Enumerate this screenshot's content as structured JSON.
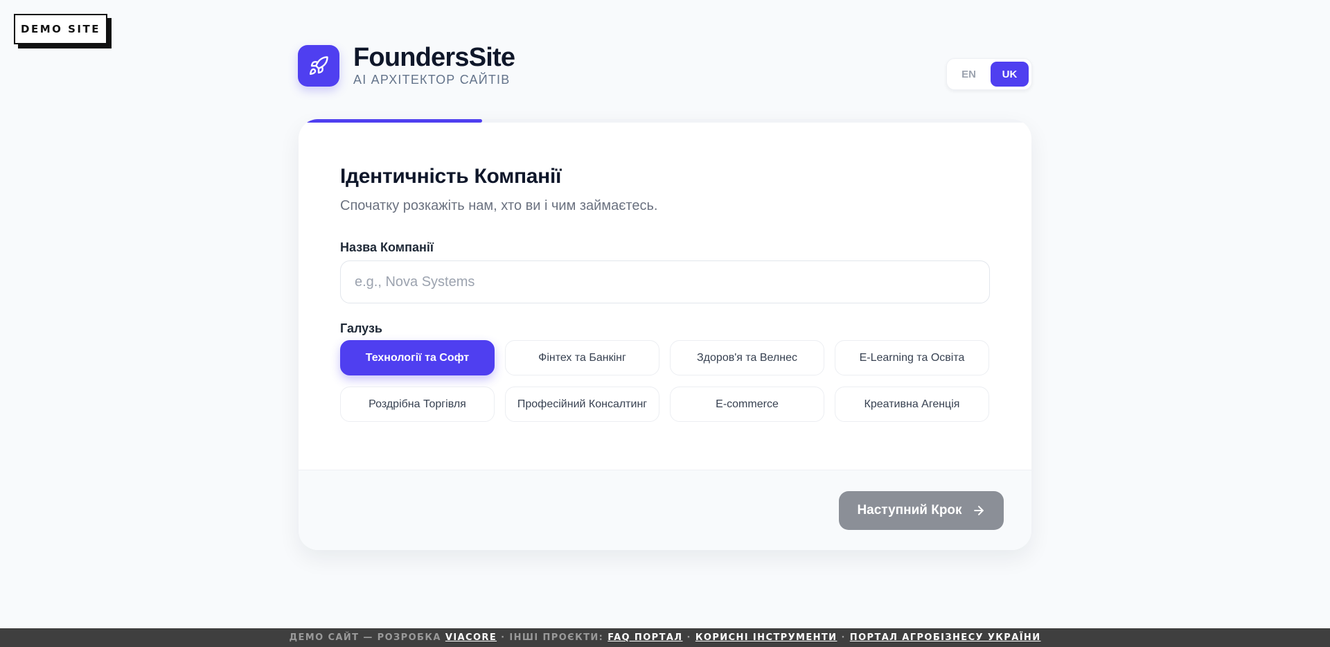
{
  "demo_badge": "DEMO SITE",
  "brand": {
    "title": "FoundersSite",
    "subtitle": "AI АРХІТЕКТОР САЙТІВ",
    "logo_icon": "rocket-icon",
    "accent_color": "#4f3ff0"
  },
  "language": {
    "options": [
      "EN",
      "UK"
    ],
    "selected": "UK"
  },
  "progress": {
    "percent": 25
  },
  "step": {
    "title": "Ідентичність Компанії",
    "subtitle": "Спочатку розкажіть нам, хто ви і чим займаєтесь.",
    "company_name": {
      "label": "Назва Компанії",
      "placeholder": "e.g., Nova Systems",
      "value": ""
    },
    "industry": {
      "label": "Галузь",
      "selected": "Технології та Софт",
      "options": [
        "Технології та Софт",
        "Фінтех та Банкінг",
        "Здоров'я та Велнес",
        "E-Learning та Освіта",
        "Роздрібна Торгівля",
        "Професійний Консалтинг",
        "E-commerce",
        "Креативна Агенція"
      ]
    }
  },
  "next_button": {
    "label": "Наступний Крок",
    "icon": "arrow-right-icon",
    "disabled_color": "#8b8f97"
  },
  "footer": {
    "prefix": "ДЕМО САЙТ — РОЗРОБКА",
    "viacore": "VIACORE",
    "middle": "· ІНШІ ПРОЄКТИ:",
    "links": [
      "FAQ ПОРТАЛ",
      "КОРИСНІ ІНСТРУМЕНТИ",
      "ПОРТАЛ АГРОБІЗНЕСУ УКРАЇНИ"
    ],
    "separator": "·"
  }
}
